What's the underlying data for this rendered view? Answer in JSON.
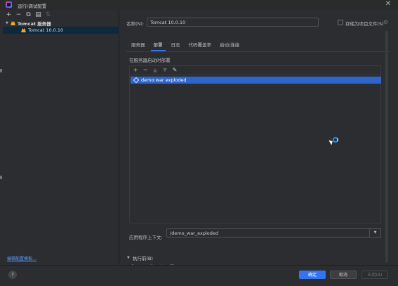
{
  "window": {
    "title": "运行/调试配置",
    "close_glyph": "✕"
  },
  "left_toolbar": {
    "icons": [
      "add-icon",
      "remove-icon",
      "copy-icon",
      "folder-icon",
      "sort-icon"
    ],
    "glyphs": [
      "+",
      "−",
      "⧉",
      "▤",
      "⇅"
    ]
  },
  "tree": {
    "group_label": "Tomcat 服务器",
    "items": [
      {
        "label": "Tomcat 10.0.10",
        "selected": true
      }
    ]
  },
  "edit_templates_link": "编辑配置模板...",
  "form": {
    "name_label": "名称(N):",
    "name_value": "Tomcat 10.0.10",
    "store_as_file_label": "存储为项目文件(S)"
  },
  "tabs": [
    {
      "label": "服务器",
      "active": false
    },
    {
      "label": "部署",
      "active": true
    },
    {
      "label": "日志",
      "active": false
    },
    {
      "label": "代码覆盖率",
      "active": false
    },
    {
      "label": "启动/连接",
      "active": false
    }
  ],
  "deploy": {
    "section_label": "在服务器启动时部署",
    "toolbar_glyphs": [
      "+",
      "−",
      "▲",
      "▼",
      "✎"
    ],
    "artifacts": [
      "demo:war exploded"
    ]
  },
  "context": {
    "label": "应用程序上下文:",
    "value": "/demo_war_exploded",
    "dropdown_glyph": "▼"
  },
  "before_launch": {
    "label": "执行前(B)",
    "toolbar_glyphs": [
      "+",
      "−",
      "✎",
      "▲",
      "▼"
    ]
  },
  "buttons": {
    "help": "?",
    "ok": "确定",
    "cancel": "取消",
    "apply": "应用(A)"
  },
  "colors": {
    "accent": "#3574f0",
    "selection": "#2f65ca",
    "link": "#589df6",
    "background": "#2b2d30"
  }
}
